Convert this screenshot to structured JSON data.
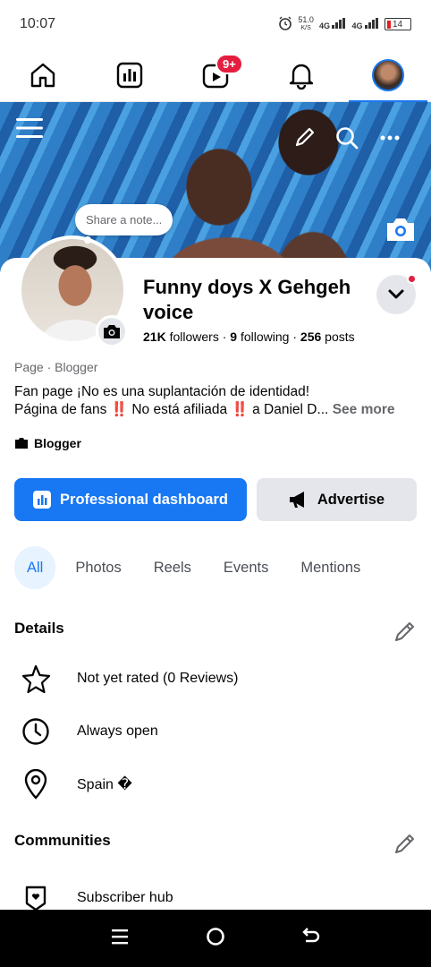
{
  "status": {
    "time": "10:07",
    "speed": "51.0",
    "speed_unit": "K/S",
    "net1": "4G",
    "net2": "4G",
    "battery": "14"
  },
  "nav": {
    "notifications_badge": "9+"
  },
  "note": {
    "placeholder": "Share a note..."
  },
  "profile": {
    "name": "Funny doys X Gehgeh voice",
    "followers_count": "21K",
    "followers_label": "followers",
    "following_count": "9",
    "following_label": "following",
    "posts_count": "256",
    "posts_label": "posts",
    "category": "Page · Blogger",
    "bio_line1": "Fan page ¡No es una suplantación de identidad!",
    "bio_line2": "Página de fans ‼️ No está afiliada ‼️ a Daniel D...",
    "see_more": "See more",
    "tag": "Blogger"
  },
  "actions": {
    "dashboard": "Professional dashboard",
    "advertise": "Advertise"
  },
  "filters": [
    "All",
    "Photos",
    "Reels",
    "Events",
    "Mentions"
  ],
  "details": {
    "title": "Details",
    "rating": "Not yet rated (0 Reviews)",
    "hours": "Always open",
    "location": "Spain �"
  },
  "communities": {
    "title": "Communities",
    "subscriber_hub": "Subscriber hub"
  },
  "colors": {
    "accent": "#1877f2",
    "badge": "#e41e3f"
  }
}
